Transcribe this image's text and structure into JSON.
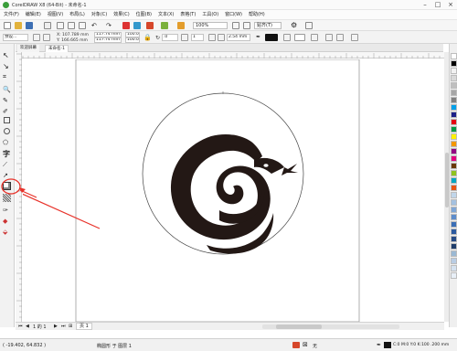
{
  "app": {
    "window_title": "CorelDRAW X8 (64-Bit) - 未命名-1"
  },
  "menu": [
    "文件(F)",
    "编辑(E)",
    "视图(V)",
    "布局(L)",
    "对象(C)",
    "效果(C)",
    "位图(B)",
    "文本(X)",
    "表格(T)",
    "工具(O)",
    "窗口(W)",
    "帮助(H)"
  ],
  "toolbar": {
    "zoom": "100%",
    "snap": "贴齐(T)"
  },
  "property_bar": {
    "preset": "预设...",
    "x": "X: 107.789 mm",
    "y": "Y: 166.665 mm",
    "width": "117.74 mm",
    "height": "117.74 mm",
    "scale_w": "100.0",
    "scale_h": "100.0",
    "rotation": ".0",
    "outline_width": "2.54 mm",
    "count": "1"
  },
  "tabs": {
    "welcome": "欢迎屏幕",
    "doc": "未命名-1"
  },
  "page_nav": {
    "page_indicator": "1 的 1",
    "page_tab": "页 1"
  },
  "status": {
    "coords": "( -19.402, 64.832 )",
    "object_info": "椭圆形 于 图层 1",
    "fill_info": "C:0 M:0 Y:0 K:100 .200 mm",
    "no_fill": "无"
  },
  "palette": [
    "#ffffff",
    "#000000",
    "#f2f2f2",
    "#d9d9d9",
    "#bfbfbf",
    "#a6a6a6",
    "#808080",
    "#00a0e9",
    "#1d2088",
    "#e60012",
    "#009944",
    "#fff100",
    "#f39800",
    "#920783",
    "#e4007f",
    "#6a3906",
    "#8fc31f",
    "#00a7c2",
    "#ea5514",
    "#c1d6ea",
    "#a4c1e0",
    "#7fa6d6",
    "#5d8ccb",
    "#3b6fb6",
    "#2c5aa0",
    "#264b86",
    "#1f3d6b",
    "#9bb8d3",
    "#b9cde4",
    "#d5e2f0",
    "#e8eff7"
  ],
  "artwork": {
    "fill": "#231815",
    "circle_stroke": "#444444",
    "annotation": "#e8322a"
  }
}
